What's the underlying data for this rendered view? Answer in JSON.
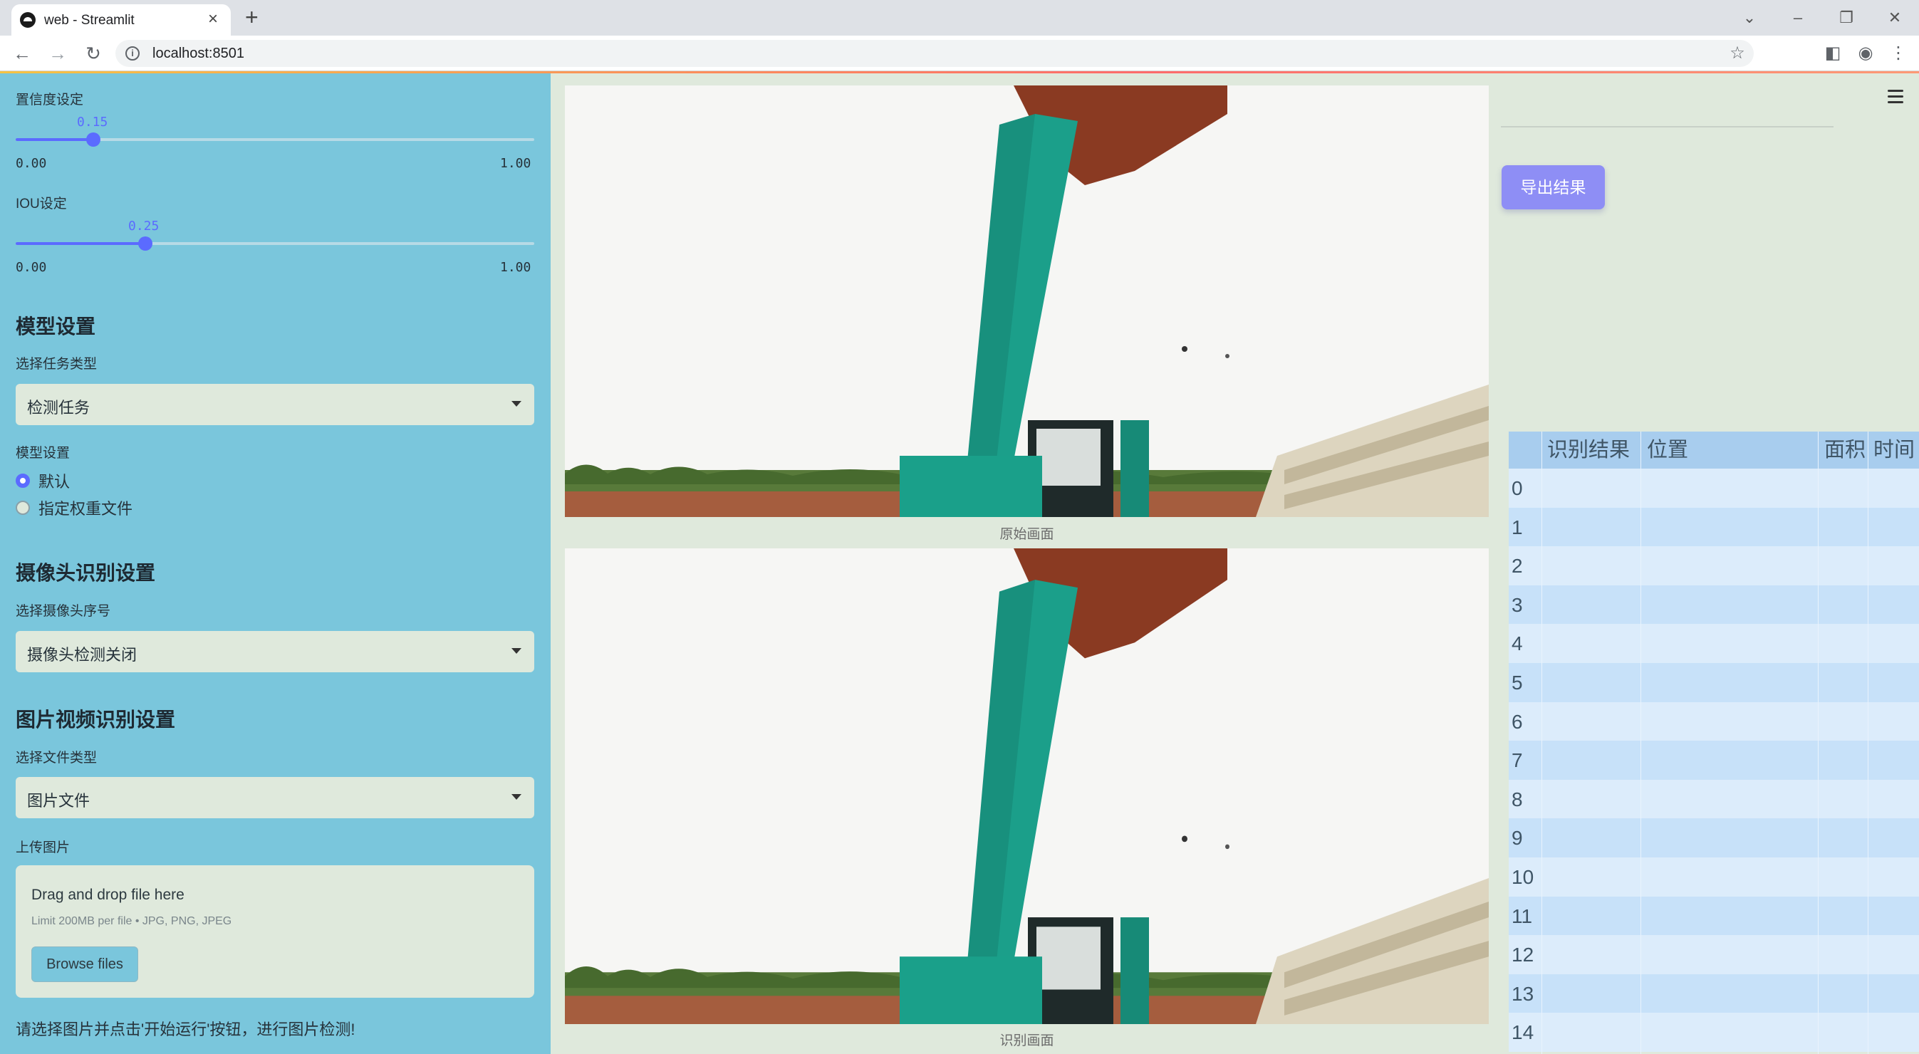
{
  "browser": {
    "tab_title": "web - Streamlit",
    "url": "localhost:8501"
  },
  "sidebar": {
    "confidence": {
      "label": "置信度设定",
      "value_text": "0.15",
      "value": 0.15,
      "min": "0.00",
      "max": "1.00"
    },
    "iou": {
      "label": "IOU设定",
      "value_text": "0.25",
      "value": 0.25,
      "min": "0.00",
      "max": "1.00"
    },
    "model_section": {
      "heading": "模型设置",
      "task_label": "选择任务类型",
      "task_value": "检测任务",
      "model_label": "模型设置",
      "options": [
        "默认",
        "指定权重文件"
      ],
      "selected_index": 0
    },
    "camera_section": {
      "heading": "摄像头识别设置",
      "camera_label": "选择摄像头序号",
      "camera_value": "摄像头检测关闭"
    },
    "file_section": {
      "heading": "图片视频识别设置",
      "type_label": "选择文件类型",
      "type_value": "图片文件",
      "upload_label": "上传图片",
      "drop_title": "Drag and drop file here",
      "drop_limit": "Limit 200MB per file • JPG, PNG, JPEG",
      "browse_label": "Browse files"
    },
    "hint": "请选择图片并点击'开始运行'按钮，进行图片检测!"
  },
  "main": {
    "original_caption": "原始画面",
    "result_caption": "识别画面"
  },
  "right": {
    "export_label": "导出结果",
    "table": {
      "columns": [
        "",
        "识别结果",
        "位置",
        "面积",
        "时间"
      ],
      "row_index": [
        "0",
        "1",
        "2",
        "3",
        "4",
        "5",
        "6",
        "7",
        "8",
        "9",
        "10",
        "11",
        "12",
        "13",
        "14"
      ]
    }
  },
  "colors": {
    "sidebar_bg": "#7ac6dc",
    "accent": "#5b6bff",
    "export_button": "#8e8ef5",
    "table_header": "#a8cdee"
  }
}
